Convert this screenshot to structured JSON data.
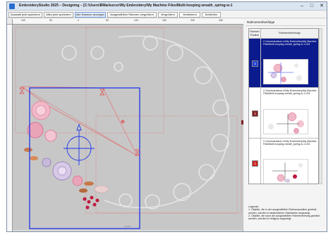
{
  "window": {
    "title": "EmbroideryStudio 2025 – Designing – [C:\\Users\\BMarkurcer\\My Embroidery\\My Machine Files\\Multi-hooping wreath_spring-w-1",
    "minimize": "–",
    "maximize": "□",
    "close": "✕"
  },
  "toolbar": {
    "buttons": [
      "Auswahl jetzt speichern",
      "Alles jetzt speichern",
      "Alle Rahmen anzeigen",
      "Ausgewählten Rahmen vergrößern",
      "Vergrößern",
      "Verkleinern",
      "Schließen"
    ]
  },
  "ruler": {
    "labels": [
      "100",
      "50",
      "0",
      "50",
      "100",
      "150",
      "200",
      "250"
    ]
  },
  "panel": {
    "title": "Rahmenreihenfolge",
    "col_position": "Rahmen Position",
    "col_order": "Rahmenreihenfolge",
    "rows": [
      {
        "number": "2",
        "path": "C:\\Users\\arestum.m\\My Embroidery\\My Machine Files\\Multi-hooping wreath_spring-w-1.U01",
        "selected": true,
        "color": "#1f3fd4"
      },
      {
        "number": "4",
        "path": "C:\\Users\\arestum.m\\My Embroidery\\My Machine Files\\Multi-hooping wreath_spring-w-1.U01",
        "selected": false,
        "color": "#8a1f1f"
      },
      {
        "number": "1",
        "path": "C:\\Users\\arestum.m\\My Embroidery\\My Machine Files\\Multi-hooping wreath_spring-w-1.U01",
        "selected": false,
        "color": "#cc2222"
      }
    ],
    "legend": [
      "Legende:",
      "1. Objekte, die in der ausgewählten Rahmenposition gestickt werden, werden in tatsächlichen Stichfarben angezeigt.",
      "2. Objekte, die nach der ausgewählten Rahmenreihung gestickt werden, werden in Hellgrau angezeigt."
    ]
  },
  "colors": {
    "hoop_active": "#1e34e8",
    "hoop_other": "#d97c7c",
    "selection": "#0b1a8c"
  }
}
